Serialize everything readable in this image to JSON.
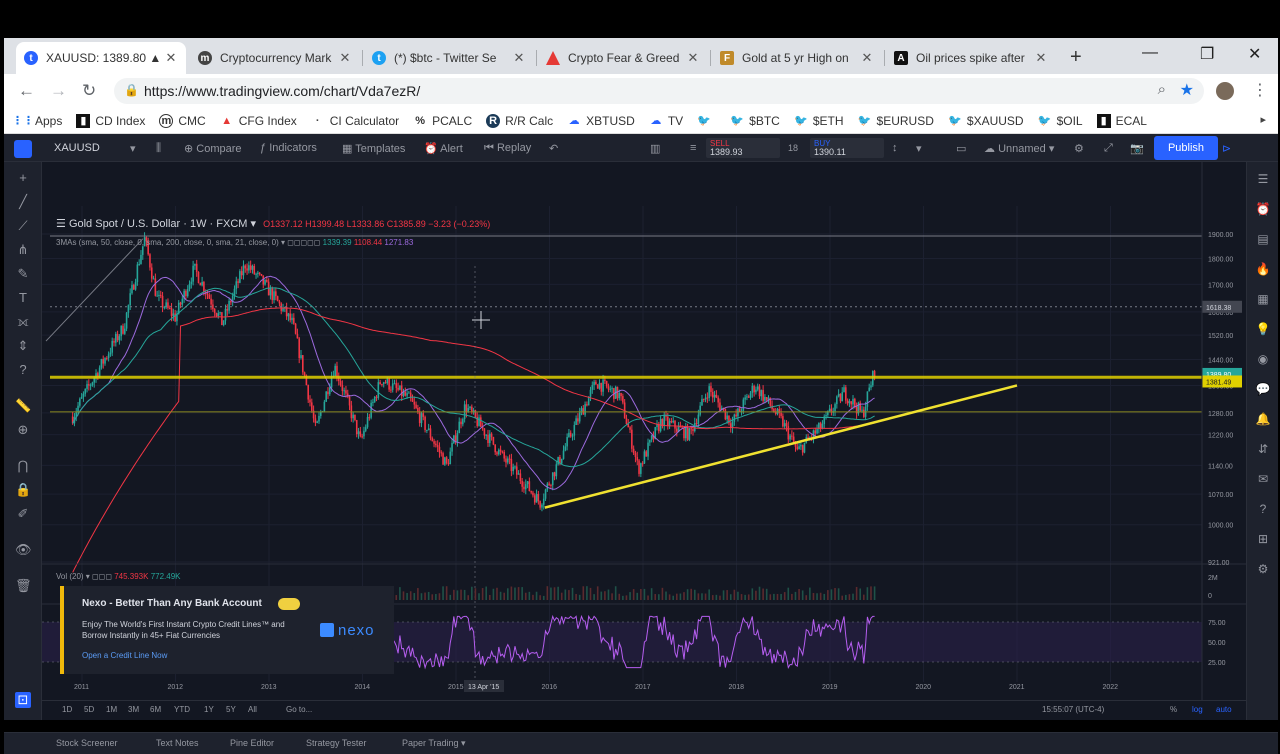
{
  "browser": {
    "tabs": [
      {
        "title": "XAUUSD: 1389.80 ▲",
        "favicon": "tradingview-icon",
        "active": true
      },
      {
        "title": "Cryptocurrency Mark",
        "favicon": "coinmarketcap-icon"
      },
      {
        "title": "(*) $btc - Twitter Se",
        "favicon": "twitter-icon"
      },
      {
        "title": "Crypto Fear & Greed",
        "favicon": "alternative-me-icon"
      },
      {
        "title": "Gold at 5 yr High on",
        "favicon": "news-icon"
      },
      {
        "title": "Oil prices spike after",
        "favicon": "news-icon"
      }
    ],
    "url": "https://www.tradingview.com/chart/Vda7ezR/",
    "bookmarks": [
      {
        "label": "Apps",
        "icon": "apps-icon"
      },
      {
        "label": "CD Index",
        "icon": "cd-icon"
      },
      {
        "label": "CMC",
        "icon": "cmc-icon"
      },
      {
        "label": "CFG Index",
        "icon": "cfg-icon"
      },
      {
        "label": "CI Calculator",
        "icon": "ci-icon"
      },
      {
        "label": "PCALC",
        "icon": "pcalc-icon"
      },
      {
        "label": "R/R Calc",
        "icon": "rr-icon"
      },
      {
        "label": "XBTUSD",
        "icon": "tv-icon"
      },
      {
        "label": "TV",
        "icon": "tv-icon"
      },
      {
        "label": "",
        "icon": "twitter-icon"
      },
      {
        "label": "$BTC",
        "icon": "twitter-icon"
      },
      {
        "label": "$ETH",
        "icon": "twitter-icon"
      },
      {
        "label": "$EURUSD",
        "icon": "twitter-icon"
      },
      {
        "label": "$XAUUSD",
        "icon": "twitter-icon"
      },
      {
        "label": "$OIL",
        "icon": "twitter-icon"
      },
      {
        "label": "ECAL",
        "icon": "ecal-icon"
      }
    ]
  },
  "tv": {
    "symbol": "XAUUSD",
    "toolbar": {
      "compare": "Compare",
      "indicators": "Indicators",
      "templates": "Templates",
      "alert": "Alert",
      "replay": "Replay",
      "unnamed": "Unnamed",
      "publish": "Publish"
    },
    "trade": {
      "sell_label": "SELL",
      "sell_price": "1389.93",
      "spread": "18",
      "buy_label": "BUY",
      "buy_price": "1390.11"
    },
    "legend": {
      "name": "Gold Spot / U.S. Dollar",
      "tf": "1W",
      "source": "FXCM",
      "ohlc": "O1337.12  H1399.48  L1333.86  C1385.89  −3.23 (−0.23%)"
    },
    "ma_legend": {
      "label": "3MAs (sma, 50, close, 0, sma, 200, close, 0, sma, 21, close, 0)",
      "v1": "1339.39",
      "v2": "1108.44",
      "v3": "1271.83"
    },
    "vol_legend": {
      "label": "Vol (20)",
      "v1": "745.393K",
      "v2": "772.49K"
    },
    "price_axis": [
      "1900.00",
      "1800.00",
      "1700.00",
      "1600.00",
      "1520.00",
      "1440.00",
      "1360.00",
      "1280.00",
      "1220.00",
      "1140.00",
      "1070.00",
      "1000.00",
      "921.00"
    ],
    "price_tags": {
      "top": "1618.38",
      "current": "1389.80",
      "level": "1381.49"
    },
    "rsi_axis": [
      "75.00",
      "50.00",
      "25.00"
    ],
    "vol_axis": [
      "2M",
      "0"
    ],
    "time_axis": [
      "2011",
      "2012",
      "2013",
      "2014",
      "2015",
      "2016",
      "2017",
      "2018",
      "2019",
      "2020",
      "2021",
      "2022"
    ],
    "time_marker": "13 Apr '15",
    "timeframes": [
      "1D",
      "5D",
      "1M",
      "3M",
      "6M",
      "YTD",
      "1Y",
      "5Y",
      "All",
      "Go to..."
    ],
    "clock": "15:55:07 (UTC-4)",
    "scale_opts": [
      "%",
      "log",
      "auto"
    ],
    "bottom_tabs": [
      "Stock Screener",
      "Text Notes",
      "Pine Editor",
      "Strategy Tester",
      "Paper Trading ▾"
    ]
  },
  "ad": {
    "title": "Nexo - Better Than Any Bank Account",
    "body": "Enjoy The World's First Instant Crypto Credit Lines™ and Borrow Instantly in 45+ Fiat Currencies",
    "link": "Open a Credit Line Now",
    "logo": "nexo"
  },
  "colors": {
    "tv_bg": "#131722",
    "up": "#26a69a",
    "down": "#f23645",
    "level": "#e0d000",
    "trend": "#f0e130",
    "accent": "#2962ff"
  }
}
